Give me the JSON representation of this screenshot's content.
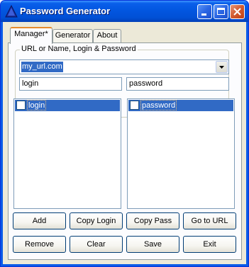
{
  "window": {
    "title": "Password Generator"
  },
  "tabs": [
    {
      "label": "Manager*",
      "active": true
    },
    {
      "label": "Generator",
      "active": false
    },
    {
      "label": "About",
      "active": false
    }
  ],
  "group": {
    "label": "URL or Name, Login & Password"
  },
  "url_combo": {
    "value": "my_url.com"
  },
  "login_field": {
    "value": "login"
  },
  "password_field": {
    "value": "password"
  },
  "login_list": {
    "items": [
      {
        "label": "login",
        "checked": false,
        "selected": true
      }
    ]
  },
  "password_list": {
    "items": [
      {
        "label": "password",
        "checked": false,
        "selected": true
      }
    ]
  },
  "buttons": {
    "add": "Add",
    "copy_login": "Copy Login",
    "copy_pass": "Copy Pass",
    "go_to_url": "Go to URL",
    "remove": "Remove",
    "clear": "Clear",
    "save": "Save",
    "exit": "Exit"
  },
  "icons": {
    "app": "blue-triangle-icon",
    "minimize": "minimize-icon",
    "maximize": "maximize-icon",
    "close": "close-icon",
    "dropdown": "chevron-down-icon"
  },
  "colors": {
    "titlebar": "#0256e0",
    "selection": "#316ac5",
    "dialog_face": "#ece9d8",
    "active_tab_accent": "#e68b2c"
  }
}
